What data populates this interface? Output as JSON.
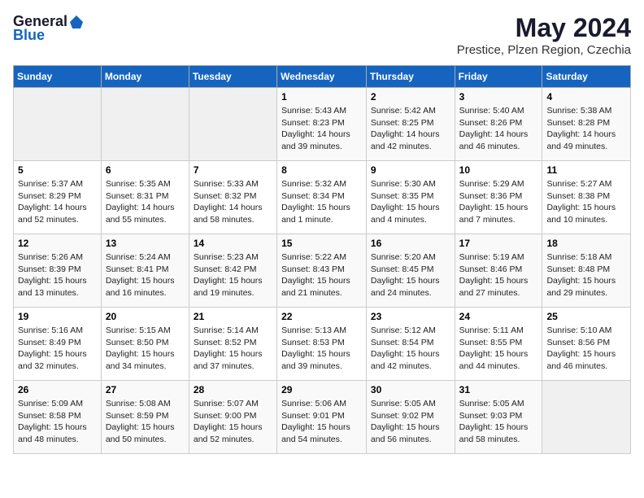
{
  "logo": {
    "general": "General",
    "blue": "Blue"
  },
  "title": "May 2024",
  "location": "Prestice, Plzen Region, Czechia",
  "days_of_week": [
    "Sunday",
    "Monday",
    "Tuesday",
    "Wednesday",
    "Thursday",
    "Friday",
    "Saturday"
  ],
  "weeks": [
    [
      {
        "day": "",
        "info": ""
      },
      {
        "day": "",
        "info": ""
      },
      {
        "day": "",
        "info": ""
      },
      {
        "day": "1",
        "info": "Sunrise: 5:43 AM\nSunset: 8:23 PM\nDaylight: 14 hours\nand 39 minutes."
      },
      {
        "day": "2",
        "info": "Sunrise: 5:42 AM\nSunset: 8:25 PM\nDaylight: 14 hours\nand 42 minutes."
      },
      {
        "day": "3",
        "info": "Sunrise: 5:40 AM\nSunset: 8:26 PM\nDaylight: 14 hours\nand 46 minutes."
      },
      {
        "day": "4",
        "info": "Sunrise: 5:38 AM\nSunset: 8:28 PM\nDaylight: 14 hours\nand 49 minutes."
      }
    ],
    [
      {
        "day": "5",
        "info": "Sunrise: 5:37 AM\nSunset: 8:29 PM\nDaylight: 14 hours\nand 52 minutes."
      },
      {
        "day": "6",
        "info": "Sunrise: 5:35 AM\nSunset: 8:31 PM\nDaylight: 14 hours\nand 55 minutes."
      },
      {
        "day": "7",
        "info": "Sunrise: 5:33 AM\nSunset: 8:32 PM\nDaylight: 14 hours\nand 58 minutes."
      },
      {
        "day": "8",
        "info": "Sunrise: 5:32 AM\nSunset: 8:34 PM\nDaylight: 15 hours\nand 1 minute."
      },
      {
        "day": "9",
        "info": "Sunrise: 5:30 AM\nSunset: 8:35 PM\nDaylight: 15 hours\nand 4 minutes."
      },
      {
        "day": "10",
        "info": "Sunrise: 5:29 AM\nSunset: 8:36 PM\nDaylight: 15 hours\nand 7 minutes."
      },
      {
        "day": "11",
        "info": "Sunrise: 5:27 AM\nSunset: 8:38 PM\nDaylight: 15 hours\nand 10 minutes."
      }
    ],
    [
      {
        "day": "12",
        "info": "Sunrise: 5:26 AM\nSunset: 8:39 PM\nDaylight: 15 hours\nand 13 minutes."
      },
      {
        "day": "13",
        "info": "Sunrise: 5:24 AM\nSunset: 8:41 PM\nDaylight: 15 hours\nand 16 minutes."
      },
      {
        "day": "14",
        "info": "Sunrise: 5:23 AM\nSunset: 8:42 PM\nDaylight: 15 hours\nand 19 minutes."
      },
      {
        "day": "15",
        "info": "Sunrise: 5:22 AM\nSunset: 8:43 PM\nDaylight: 15 hours\nand 21 minutes."
      },
      {
        "day": "16",
        "info": "Sunrise: 5:20 AM\nSunset: 8:45 PM\nDaylight: 15 hours\nand 24 minutes."
      },
      {
        "day": "17",
        "info": "Sunrise: 5:19 AM\nSunset: 8:46 PM\nDaylight: 15 hours\nand 27 minutes."
      },
      {
        "day": "18",
        "info": "Sunrise: 5:18 AM\nSunset: 8:48 PM\nDaylight: 15 hours\nand 29 minutes."
      }
    ],
    [
      {
        "day": "19",
        "info": "Sunrise: 5:16 AM\nSunset: 8:49 PM\nDaylight: 15 hours\nand 32 minutes."
      },
      {
        "day": "20",
        "info": "Sunrise: 5:15 AM\nSunset: 8:50 PM\nDaylight: 15 hours\nand 34 minutes."
      },
      {
        "day": "21",
        "info": "Sunrise: 5:14 AM\nSunset: 8:52 PM\nDaylight: 15 hours\nand 37 minutes."
      },
      {
        "day": "22",
        "info": "Sunrise: 5:13 AM\nSunset: 8:53 PM\nDaylight: 15 hours\nand 39 minutes."
      },
      {
        "day": "23",
        "info": "Sunrise: 5:12 AM\nSunset: 8:54 PM\nDaylight: 15 hours\nand 42 minutes."
      },
      {
        "day": "24",
        "info": "Sunrise: 5:11 AM\nSunset: 8:55 PM\nDaylight: 15 hours\nand 44 minutes."
      },
      {
        "day": "25",
        "info": "Sunrise: 5:10 AM\nSunset: 8:56 PM\nDaylight: 15 hours\nand 46 minutes."
      }
    ],
    [
      {
        "day": "26",
        "info": "Sunrise: 5:09 AM\nSunset: 8:58 PM\nDaylight: 15 hours\nand 48 minutes."
      },
      {
        "day": "27",
        "info": "Sunrise: 5:08 AM\nSunset: 8:59 PM\nDaylight: 15 hours\nand 50 minutes."
      },
      {
        "day": "28",
        "info": "Sunrise: 5:07 AM\nSunset: 9:00 PM\nDaylight: 15 hours\nand 52 minutes."
      },
      {
        "day": "29",
        "info": "Sunrise: 5:06 AM\nSunset: 9:01 PM\nDaylight: 15 hours\nand 54 minutes."
      },
      {
        "day": "30",
        "info": "Sunrise: 5:05 AM\nSunset: 9:02 PM\nDaylight: 15 hours\nand 56 minutes."
      },
      {
        "day": "31",
        "info": "Sunrise: 5:05 AM\nSunset: 9:03 PM\nDaylight: 15 hours\nand 58 minutes."
      },
      {
        "day": "",
        "info": ""
      }
    ]
  ]
}
